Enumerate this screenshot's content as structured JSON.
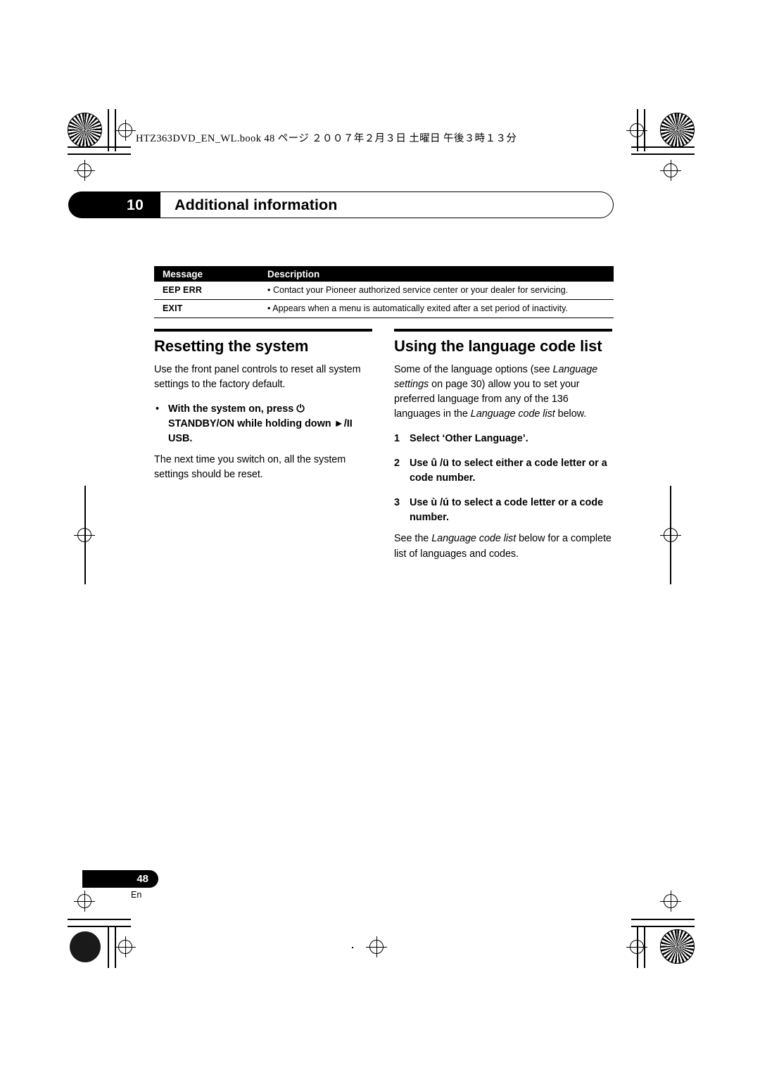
{
  "header": {
    "filename_line": "HTZ363DVD_EN_WL.book   48 ページ   ２００７年２月３日   土曜日   午後３時１３分"
  },
  "chapter": {
    "number": "10",
    "title": "Additional information"
  },
  "message_table": {
    "headers": [
      "Message",
      "Description"
    ],
    "rows": [
      {
        "message": "EEP ERR",
        "description": "• Contact your Pioneer authorized service center or your dealer for servicing."
      },
      {
        "message": "EXIT",
        "description": "• Appears when a menu is automatically exited after a set period of inactivity."
      }
    ]
  },
  "left_column": {
    "heading": "Resetting the system",
    "paragraph_1": "Use the front panel controls to reset all system settings to the factory default.",
    "bullet_1": "With the system on, press ⏻ STANDBY/ON while holding down ►/II USB.",
    "paragraph_2": "The next time you switch on, all the system settings should be reset."
  },
  "right_column": {
    "heading": "Using the language code list",
    "intro_part_1": "Some of the language options (see ",
    "intro_italic_1": "Language settings",
    "intro_part_2": " on page 30) allow you to set your preferred language from any of the 136 languages in the ",
    "intro_italic_2": "Language code list",
    "intro_part_3": " below.",
    "steps": [
      {
        "n": "1",
        "text": "Select ‘Other Language’."
      },
      {
        "n": "2",
        "text": "Use û /ü  to select either a code letter or a code number."
      },
      {
        "n": "3",
        "text": "Use ù /ú  to select a code letter or a code number."
      }
    ],
    "closing_part_1": "See the ",
    "closing_italic": "Language code list",
    "closing_part_2": " below for a complete list of languages and codes."
  },
  "footer": {
    "page_number": "48",
    "language_code": "En"
  }
}
